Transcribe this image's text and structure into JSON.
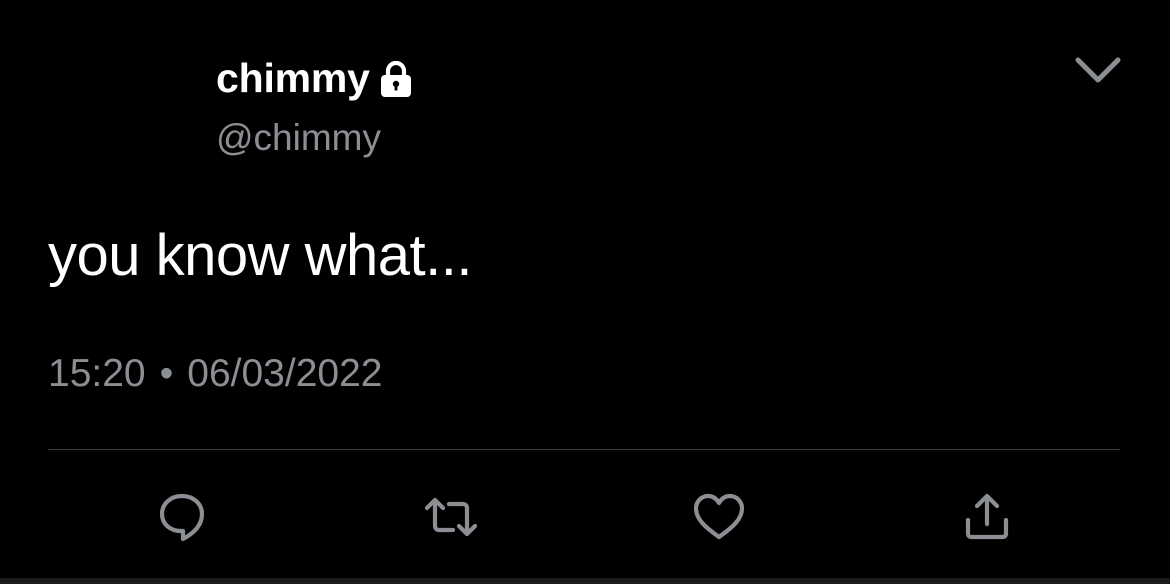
{
  "tweet": {
    "display_name": "chimmy",
    "handle": "@chimmy",
    "text": "you know what...",
    "time": "15:20",
    "separator": "•",
    "date": "06/03/2022",
    "account_protected": true
  },
  "icons": {
    "protected": "lock-icon",
    "menu": "chevron-down-icon",
    "reply": "reply-icon",
    "retweet": "retweet-icon",
    "like": "heart-icon",
    "share": "share-icon"
  },
  "colors": {
    "background": "#000000",
    "primary_text": "#ffffff",
    "secondary_text": "#8b8f94",
    "icon": "#8b8f94",
    "divider": "#3a3d40"
  }
}
